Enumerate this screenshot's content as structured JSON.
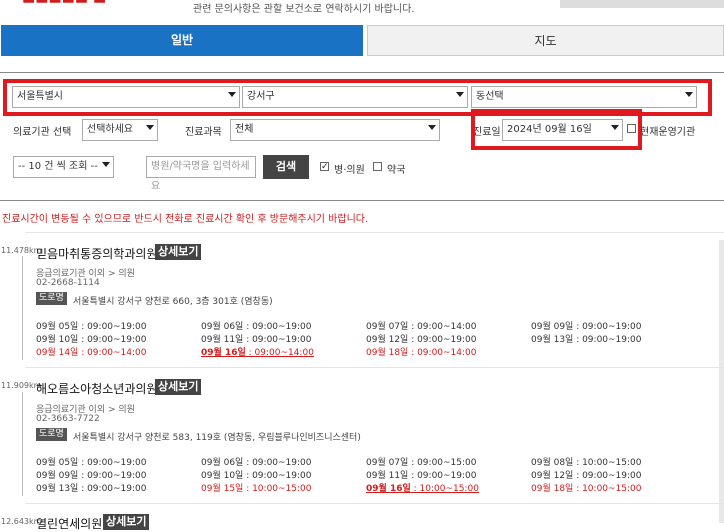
{
  "header": {
    "notice": "관련 문의사항은 관할 보건소로 연락하시기 바랍니다."
  },
  "tabs": [
    {
      "label": "일반"
    },
    {
      "label": "지도"
    }
  ],
  "filters": {
    "city": "서울특별시",
    "district": "강서구",
    "dong": "동선택",
    "institution_label": "의료기관 선택",
    "institution_value": "선택하세요",
    "department_label": "진료과목",
    "department_value": "전체",
    "date_label": "진료일",
    "date_value": "2024년 09월 16일",
    "currently_open_label": "현재운영기관",
    "page_size": "-- 10 건 씩 조회 --",
    "search_placeholder": "병원/약국명을 입력하세요",
    "search_button": "검색",
    "hospital_label": "병·의원",
    "pharmacy_label": "약국"
  },
  "warning": "진료시간이 변동될 수 있으므로 반드시 전화로 진료시간 확인 후 방문해주시기 바랍니다.",
  "detail_label": "상세보기",
  "road_label": "도로명",
  "results": [
    {
      "distance": "11.478km",
      "name": "믿음마취통증의학과의원",
      "category": "응급의료기관 이외 > 의원",
      "phone": "02-2668-1114",
      "address": "서울특별시 강서구 양천로 660, 3층 301호 (염창동)",
      "hours": [
        {
          "day": "09월 05일",
          "time": " : 09:00~19:00"
        },
        {
          "day": "09월 06일",
          "time": " : 09:00~19:00"
        },
        {
          "day": "09월 07일",
          "time": " : 09:00~14:00"
        },
        {
          "day": "09월 09일",
          "time": " : 09:00~19:00"
        },
        {
          "day": "09월 10일",
          "time": " : 09:00~19:00"
        },
        {
          "day": "09월 11일",
          "time": " : 09:00~19:00"
        },
        {
          "day": "09월 12일",
          "time": " : 09:00~19:00"
        },
        {
          "day": "09월 13일",
          "time": " : 09:00~19:00"
        },
        {
          "day": "09월 14일",
          "time": " : 09:00~14:00"
        },
        {
          "day": "09월 16일",
          "time": " : 09:00~14:00"
        },
        {
          "day": "09월 18일",
          "time": " : 09:00~14:00"
        }
      ]
    },
    {
      "distance": "11.909km",
      "name": "해오름소아청소년과의원",
      "category": "응급의료기관 이외 > 의원",
      "phone": "02-3663-7722",
      "address": "서울특별시 강서구 양천로 583, 119호 (염창동, 우림블루나인비즈니스센터)",
      "hours": [
        {
          "day": "09월 05일",
          "time": " : 09:00~19:00"
        },
        {
          "day": "09월 06일",
          "time": " : 09:00~19:00"
        },
        {
          "day": "09월 07일",
          "time": " : 09:00~15:00"
        },
        {
          "day": "09월 08일",
          "time": " : 10:00~15:00"
        },
        {
          "day": "09월 09일",
          "time": " : 09:00~19:00"
        },
        {
          "day": "09월 10일",
          "time": " : 09:00~19:00"
        },
        {
          "day": "09월 11일",
          "time": " : 09:00~19:00"
        },
        {
          "day": "09월 12일",
          "time": " : 09:00~19:00"
        },
        {
          "day": "09월 13일",
          "time": " : 09:00~19:00"
        },
        {
          "day": "09월 15일",
          "time": " : 10:00~15:00"
        },
        {
          "day": "09월 16일",
          "time": " : 10:00~15:00"
        },
        {
          "day": "09월 18일",
          "time": " : 10:00~15:00"
        }
      ]
    },
    {
      "distance": "12.643km",
      "name": "열린연세의원"
    }
  ],
  "colors": {
    "tab_active": "#1a72c4",
    "highlight_box": "#e0191e",
    "holiday_text": "#d21b1b"
  }
}
